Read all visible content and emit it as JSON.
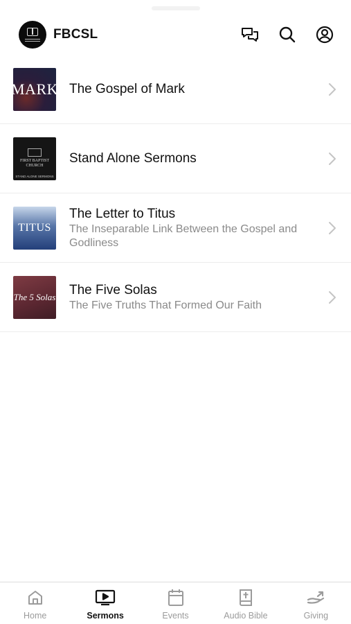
{
  "app": {
    "title": "FBCSL"
  },
  "header": {
    "icons": [
      "chat-icon",
      "search-icon",
      "profile-icon"
    ]
  },
  "sermons": [
    {
      "title": "The Gospel of Mark",
      "subtitle": "",
      "thumb_text": "MARK"
    },
    {
      "title": "Stand Alone Sermons",
      "subtitle": "",
      "thumb_text": "FIRST BAPTIST CHURCH",
      "thumb_strip": "STAND ALONE SERMONS"
    },
    {
      "title": "The Letter to Titus",
      "subtitle": "The Inseparable Link Between the Gospel and Godliness",
      "thumb_text": "TITUS"
    },
    {
      "title": "The Five Solas",
      "subtitle": "The Five Truths That Formed Our Faith",
      "thumb_text": "The 5 Solas"
    }
  ],
  "tabs": [
    {
      "label": "Home",
      "icon": "home-icon",
      "active": false
    },
    {
      "label": "Sermons",
      "icon": "play-icon",
      "active": true
    },
    {
      "label": "Events",
      "icon": "calendar-icon",
      "active": false
    },
    {
      "label": "Audio Bible",
      "icon": "bible-icon",
      "active": false
    },
    {
      "label": "Giving",
      "icon": "giving-hand-icon",
      "active": false
    }
  ],
  "colors": {
    "text_primary": "#111111",
    "text_secondary": "#8a8a8a",
    "tab_inactive": "#9b9b9b",
    "divider": "#ececec"
  }
}
